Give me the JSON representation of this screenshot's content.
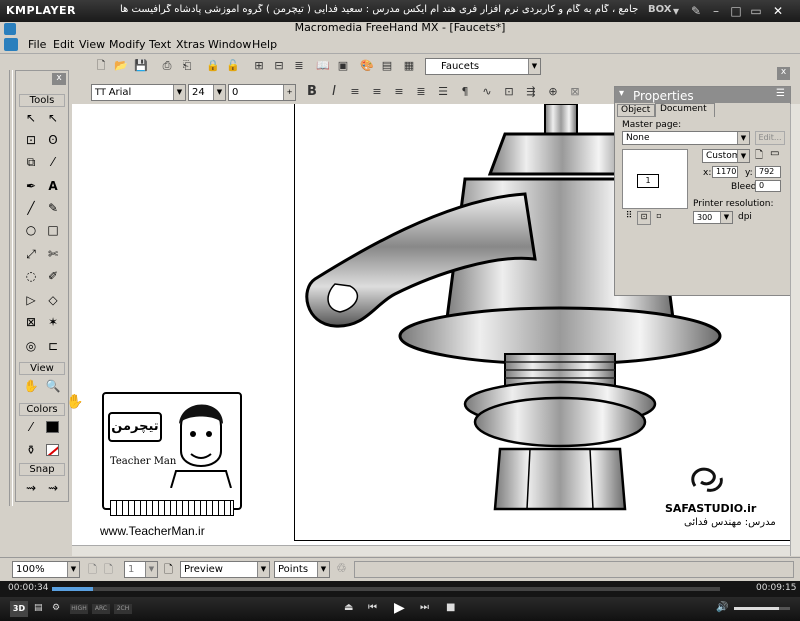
{
  "player": {
    "logo": "KMPLAYER",
    "title": "مجموعه آموزشی جامع ، گام به گام و کاربردی نرم افزار فری هند ام ایکس   مدرس : سعید فدایی ( تیچرمن ) گروه آموزشی پادشاه گرافیست ها",
    "box_label": "BOX",
    "time_elapsed": "00:00:34",
    "time_total": "00:09:15",
    "progress": 0.061,
    "volume": 0.8,
    "mode_buttons": [
      "3D",
      "HIGH",
      "ARC",
      "2CH"
    ]
  },
  "app": {
    "title": "Macromedia FreeHand MX - [Faucets*]"
  },
  "menu": [
    "File",
    "Edit",
    "View",
    "Modify",
    "Text",
    "Xtras",
    "Window",
    "Help"
  ],
  "toolbar": {
    "document_select": "Faucets"
  },
  "text_toolbar": {
    "font_name": "Arial",
    "font_size": "24",
    "leading": "0"
  },
  "tools_panel": {
    "sections": [
      "Tools",
      "View",
      "Colors",
      "Snap"
    ]
  },
  "properties": {
    "title": "Properties",
    "tabs": [
      "Object",
      "Document"
    ],
    "active_tab": "Document",
    "master_page_label": "Master page:",
    "master_page_value": "None",
    "edit_button": "Edit...",
    "page_count": "1",
    "page_size_select": "Custom",
    "x_label": "x:",
    "x_value": "1170",
    "y_label": "y:",
    "y_value": "792",
    "bleed_label": "Bleed:",
    "bleed_value": "0",
    "printer_resolution_label": "Printer resolution:",
    "printer_resolution_value": "300",
    "dpi_label": "dpi"
  },
  "overlay": {
    "teacher_logo_text": "تیچرمن",
    "teacher_name": "Teacher Man",
    "website": "www.TeacherMan.ir",
    "studio": "SAFASTUDIO.ir",
    "instructor": "مدرس: مهندس فدائی"
  },
  "status_bar": {
    "zoom": "100%",
    "page": "1",
    "view_mode": "Preview",
    "units": "Points"
  }
}
